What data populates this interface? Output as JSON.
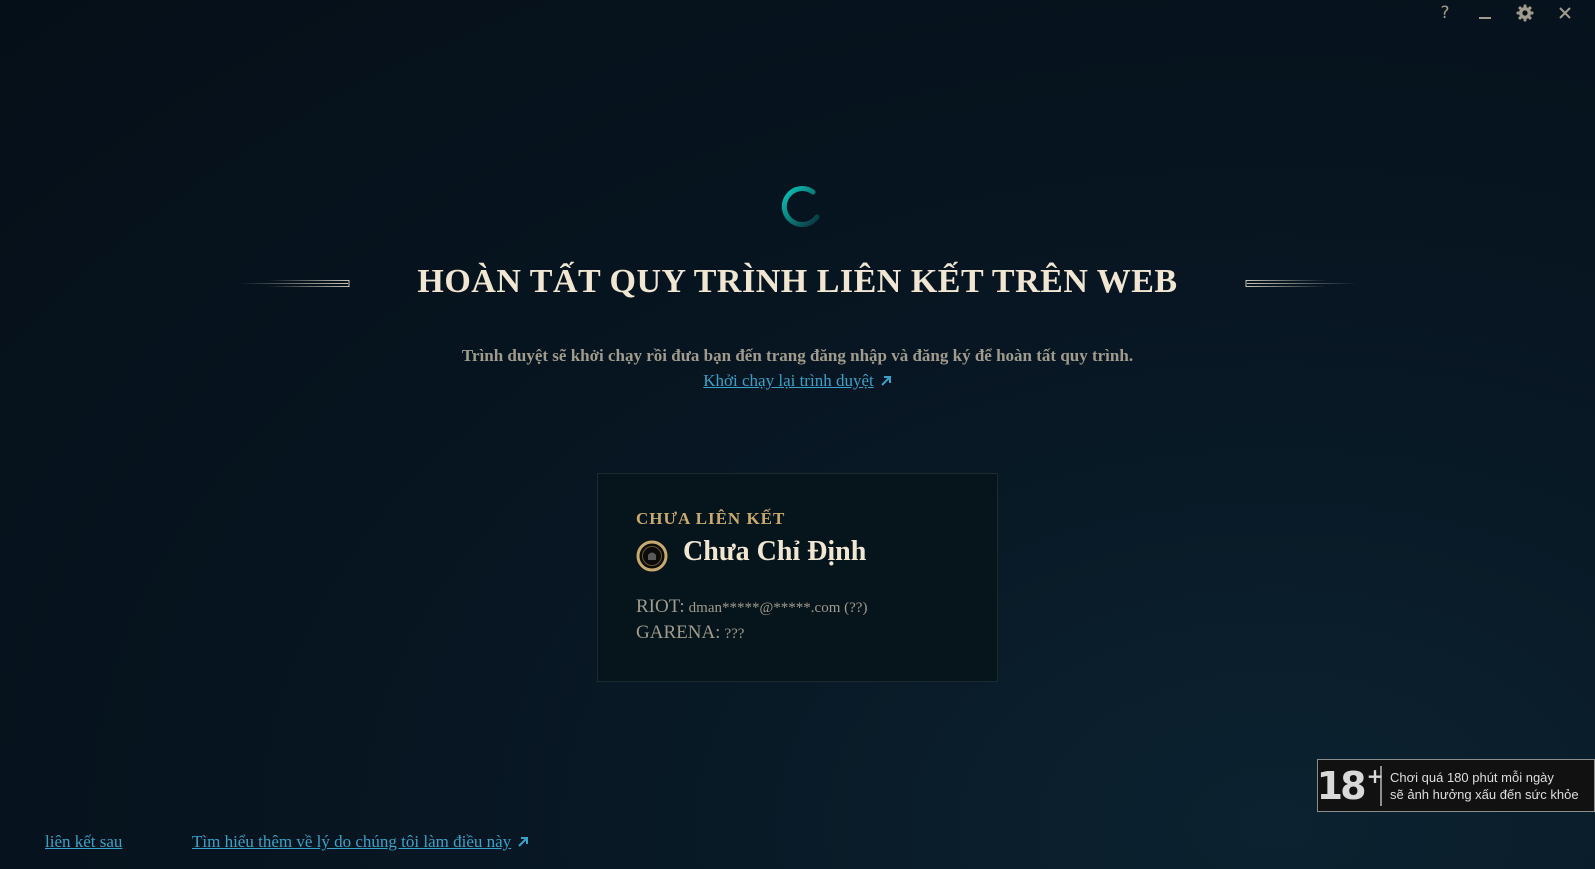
{
  "window_controls": [
    {
      "name": "help-button",
      "icon": "help-icon",
      "label": "?"
    },
    {
      "name": "minimize-button",
      "icon": "minimize-icon"
    },
    {
      "name": "settings-button",
      "icon": "gear-icon"
    },
    {
      "name": "close-button",
      "icon": "close-icon"
    }
  ],
  "status": {
    "icon": "loading-spinner-icon"
  },
  "heading": {
    "title": "HOÀN TẤT QUY TRÌNH LIÊN KẾT TRÊN WEB",
    "subtitle": "Trình duyệt sẽ khởi chạy rồi đưa bạn đến trang đăng nhập và đăng ký để hoàn tất quy trình.",
    "relaunch_link": "Khởi chạy lại trình duyệt",
    "relaunch_icon": "external-link-icon"
  },
  "account_card": {
    "status_label": "CHƯA LIÊN KẾT",
    "avatar_icon": "profile-icon",
    "name": "Chưa Chỉ Định",
    "riot_label": "RIOT:",
    "riot_value": "dman*****@*****.com (??)",
    "garena_label": "GARENA:",
    "garena_value": "???"
  },
  "footer": {
    "link_later": "liên kết sau",
    "link_learn_more": "Tìm hiểu thêm về lý do chúng tôi làm điều này",
    "learn_more_icon": "external-link-icon"
  },
  "age_rating": {
    "number": "18",
    "plus": "+",
    "line1": "Chơi quá 180 phút mỗi ngày",
    "line2": "sẽ ảnh hưởng xấu đến sức khỏe"
  },
  "colors": {
    "background": "#050f18",
    "title_text": "#f0e6d2",
    "body_text": "#a09b8c",
    "link": "#3aa2c8",
    "gold": "#c8aa6e",
    "spinner": "#0ac8b9"
  }
}
